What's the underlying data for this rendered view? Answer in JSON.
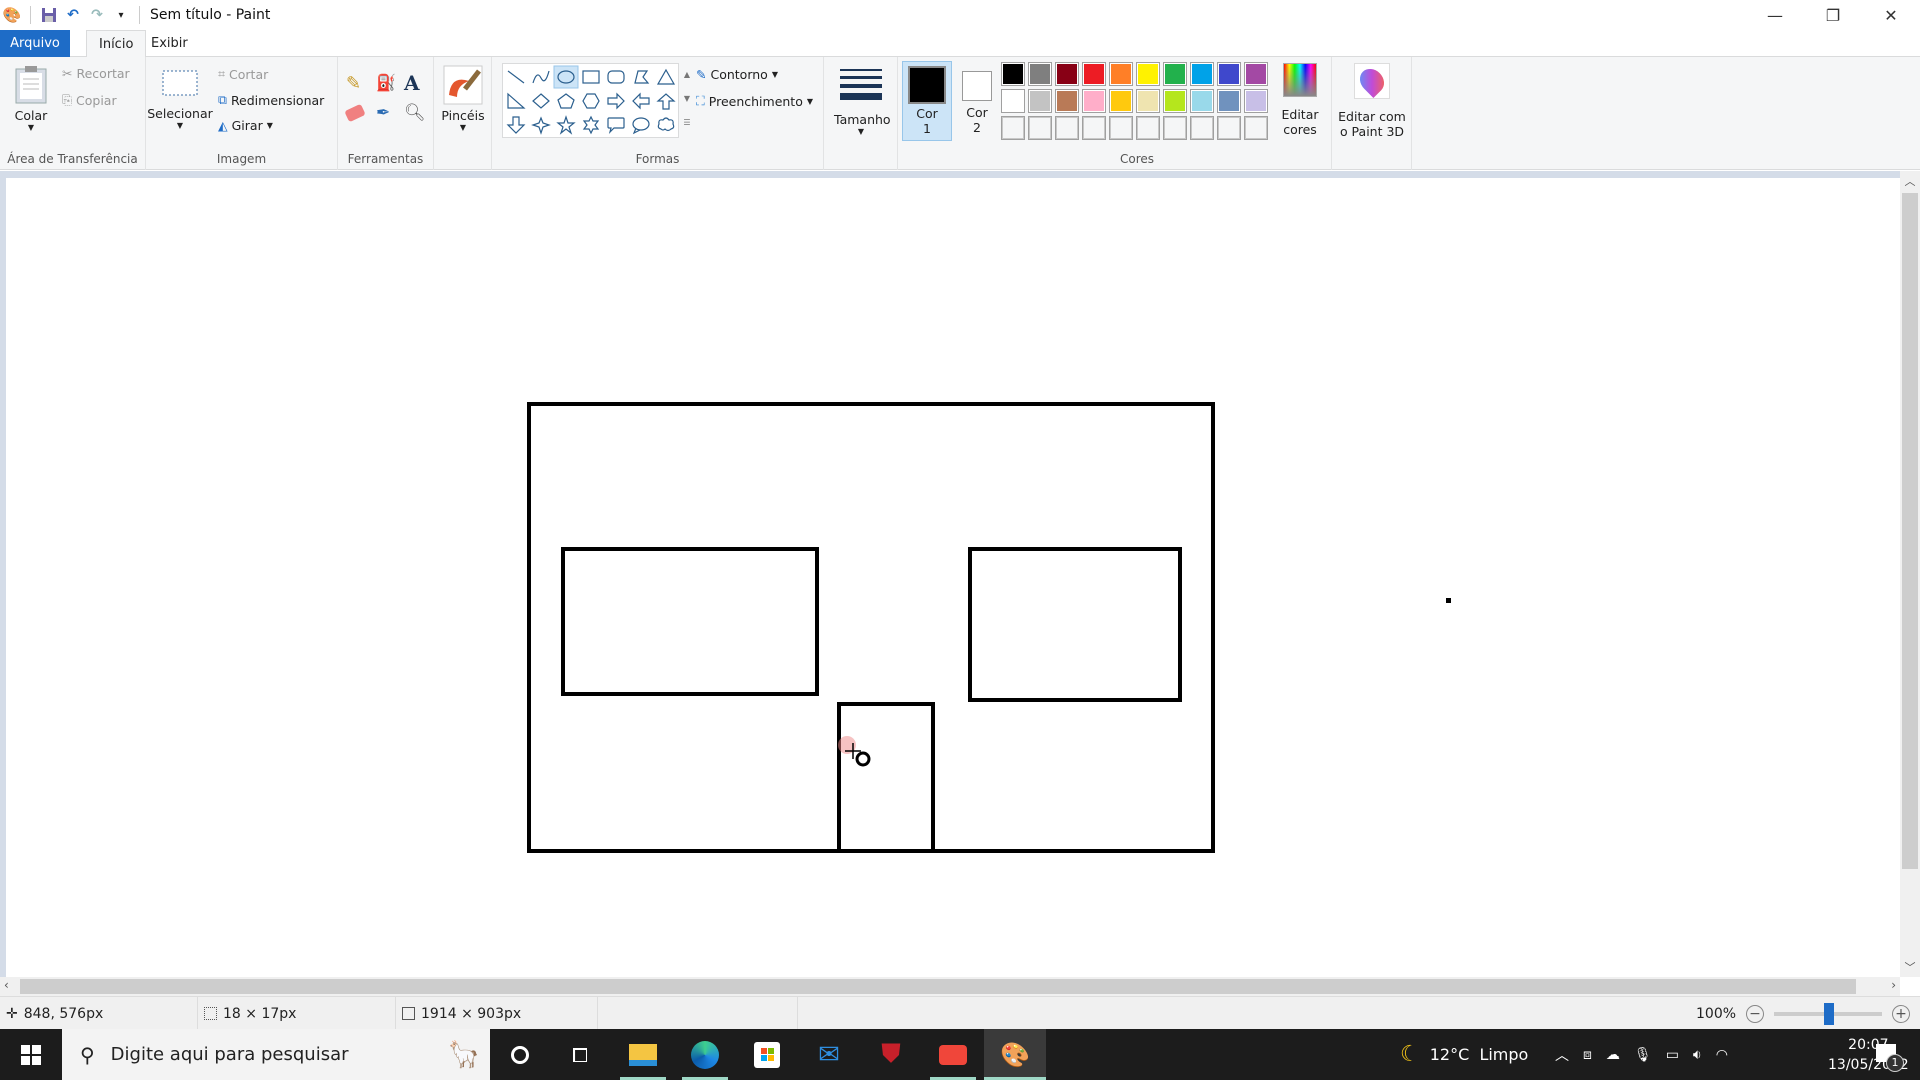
{
  "window": {
    "title": "Sem título - Paint",
    "controls": {
      "minimize": "—",
      "maximize": "❐",
      "close": "✕"
    }
  },
  "quick_access": [
    "paint-app-icon",
    "save-icon",
    "undo-icon",
    "redo-icon",
    "customize-dropdown-icon"
  ],
  "tabs": [
    {
      "label": "Arquivo",
      "active": false
    },
    {
      "label": "Início",
      "active": true
    },
    {
      "label": "Exibir",
      "active": false
    }
  ],
  "ribbon": {
    "clipboard": {
      "group_label": "Área de Transferência",
      "paste": "Colar",
      "cut": "Recortar",
      "copy": "Copiar"
    },
    "image": {
      "group_label": "Imagem",
      "select": "Selecionar",
      "crop": "Cortar",
      "resize": "Redimensionar",
      "rotate": "Girar"
    },
    "tools": {
      "group_label": "Ferramentas",
      "items": [
        "pencil",
        "fill",
        "text",
        "eraser",
        "color-picker",
        "magnifier"
      ]
    },
    "brushes": {
      "label": "Pincéis"
    },
    "shapes": {
      "group_label": "Formas",
      "items": [
        "line",
        "curve",
        "oval",
        "rectangle",
        "rounded-rectangle",
        "polygon",
        "triangle",
        "right-triangle",
        "diamond",
        "pentagon",
        "hexagon",
        "right-arrow",
        "left-arrow",
        "up-arrow",
        "down-arrow",
        "four-point-star",
        "five-point-star",
        "six-point-star",
        "rounded-callout",
        "oval-callout",
        "cloud-callout"
      ],
      "selected": "oval",
      "outline": "Contorno",
      "fill": "Preenchimento"
    },
    "size": {
      "label": "Tamanho"
    },
    "colors": {
      "group_label": "Cores",
      "color1_label": "Cor",
      "color1_num": "1",
      "color2_label": "Cor",
      "color2_num": "2",
      "color1": "#000000",
      "color2": "#ffffff",
      "palette_row1": [
        "#000000",
        "#7f7f7f",
        "#880015",
        "#ed1c24",
        "#ff7f27",
        "#fff200",
        "#22b14c",
        "#00a2e8",
        "#3f48cc",
        "#a349a4"
      ],
      "palette_row2": [
        "#ffffff",
        "#c3c3c3",
        "#b97a57",
        "#ffaec9",
        "#ffc90e",
        "#efe4b0",
        "#b5e61d",
        "#99d9ea",
        "#7092be",
        "#c8bfe7"
      ],
      "edit_colors_line1": "Editar",
      "edit_colors_line2": "cores"
    },
    "paint3d": {
      "line1": "Editar com",
      "line2": "o Paint 3D"
    }
  },
  "canvas": {
    "drawing": "house outline: outer rectangle, two windows, a door, and a small dot",
    "stroke_color": "#000000"
  },
  "statusbar": {
    "cursor_position": "848, 576px",
    "selection_size": "18 × 17px",
    "image_size": "1914 × 903px",
    "zoom": "100%"
  },
  "taskbar": {
    "search_placeholder": "Digite aqui para pesquisar",
    "apps": [
      "cortana",
      "task-view",
      "file-explorer",
      "edge",
      "microsoft-store",
      "mail",
      "mcafee",
      "camera-recorder",
      "paint"
    ],
    "weather": "12°C  Limpo",
    "time": "20:07",
    "date": "13/05/2022",
    "notification_count": "1"
  }
}
